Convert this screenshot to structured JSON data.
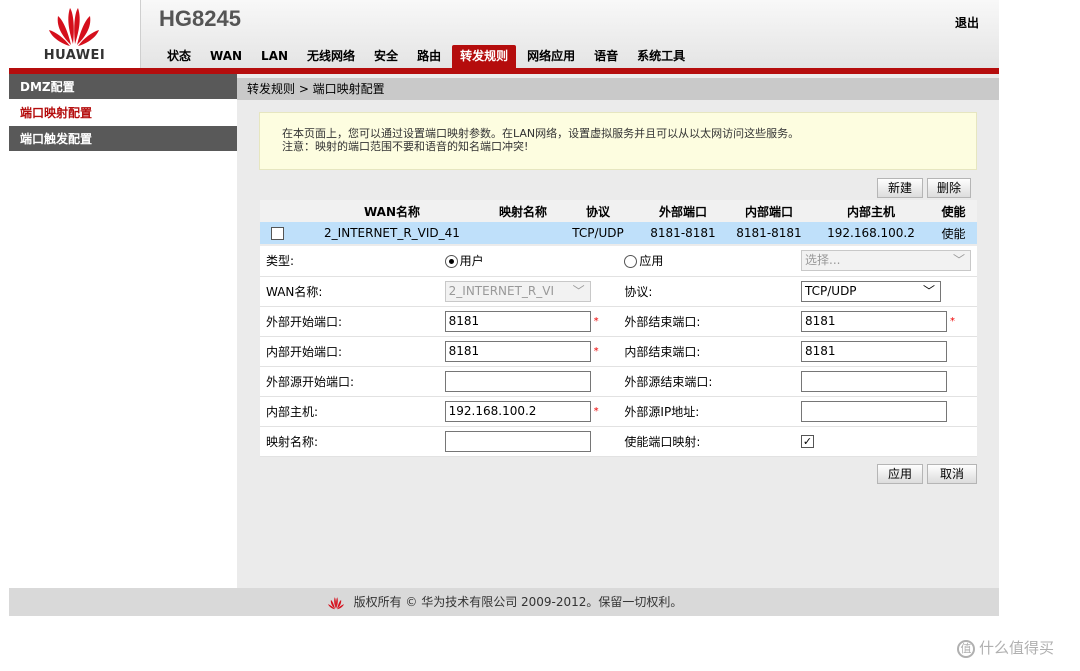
{
  "header": {
    "brand": "HUAWEI",
    "model": "HG8245",
    "logout": "退出",
    "nav": [
      "状态",
      "WAN",
      "LAN",
      "无线网络",
      "安全",
      "路由",
      "转发规则",
      "网络应用",
      "语音",
      "系统工具"
    ],
    "active_nav": "转发规则"
  },
  "sidebar": {
    "items": [
      {
        "label": "DMZ配置"
      },
      {
        "label": "端口映射配置"
      },
      {
        "label": "端口触发配置"
      }
    ],
    "active": "端口映射配置"
  },
  "breadcrumb": "转发规则 > 端口映射配置",
  "notice": {
    "line1": "在本页面上，您可以通过设置端口映射参数。在LAN网络，设置虚拟服务并且可以从以太网访问这些服务。",
    "line2": "注意：映射的端口范围不要和语音的知名端口冲突!"
  },
  "buttons": {
    "new": "新建",
    "delete": "删除",
    "apply": "应用",
    "cancel": "取消"
  },
  "table": {
    "columns": [
      "WAN名称",
      "映射名称",
      "协议",
      "外部端口",
      "内部端口",
      "内部主机",
      "使能"
    ],
    "rows": [
      {
        "wan": "2_INTERNET_R_VID_41",
        "name": "",
        "protocol": "TCP/UDP",
        "ext_port": "8181-8181",
        "int_port": "8181-8181",
        "host": "192.168.100.2",
        "enable": "使能"
      }
    ]
  },
  "form": {
    "type_label": "类型:",
    "type_user": "用户",
    "type_app": "应用",
    "type_selected": "用户",
    "app_select_placeholder": "选择...",
    "wan_label": "WAN名称:",
    "wan_value": "2_INTERNET_R_VI",
    "protocol_label": "协议:",
    "protocol_value": "TCP/UDP",
    "ext_start_label": "外部开始端口:",
    "ext_start_value": "8181",
    "ext_end_label": "外部结束端口:",
    "ext_end_value": "8181",
    "int_start_label": "内部开始端口:",
    "int_start_value": "8181",
    "int_end_label": "内部结束端口:",
    "int_end_value": "8181",
    "src_start_label": "外部源开始端口:",
    "src_start_value": "",
    "src_end_label": "外部源结束端口:",
    "src_end_value": "",
    "host_label": "内部主机:",
    "host_value": "192.168.100.2",
    "src_ip_label": "外部源IP地址:",
    "src_ip_value": "",
    "map_name_label": "映射名称:",
    "map_name_value": "",
    "enable_label": "使能端口映射:",
    "enable_checked": true,
    "check_mark": "✓",
    "required_mark": "*"
  },
  "footer": {
    "copyright": "版权所有 © 华为技术有限公司 2009-2012。保留一切权利。"
  },
  "watermark": {
    "icon": "值",
    "text": "什么值得买"
  },
  "colors": {
    "accent": "#b50d0d",
    "sidebar_bg": "#595959",
    "row_highlight": "#bfe0fa",
    "notice_bg": "#fdfde0"
  }
}
